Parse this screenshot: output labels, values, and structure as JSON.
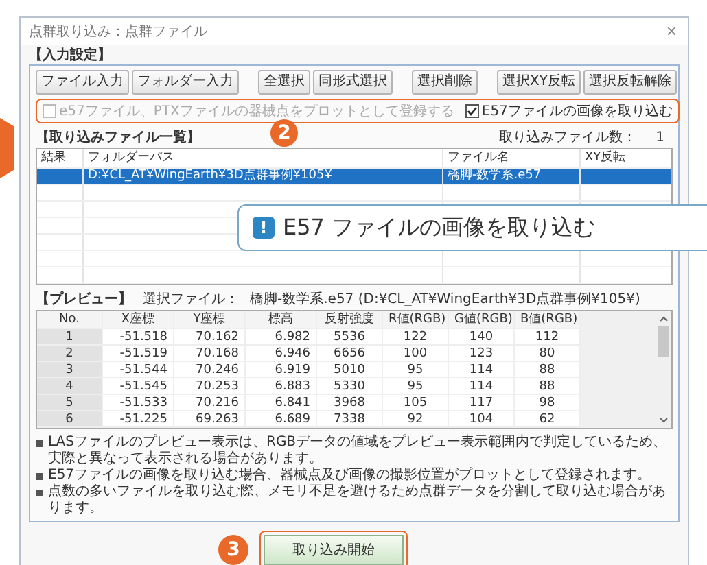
{
  "window": {
    "title": "点群取り込み：点群ファイル",
    "close": "×"
  },
  "input_settings": {
    "title": "【入力設定】",
    "buttons": [
      "ファイル入力",
      "フォルダー入力",
      "全選択",
      "同形式選択",
      "選択削除",
      "選択XY反転",
      "選択反転解除"
    ],
    "options": [
      {
        "label": "e57ファイル、PTXファイルの器械点をプロットとして登録する",
        "checked": false,
        "disabled": true
      },
      {
        "label": "E57ファイルの画像を取り込む",
        "checked": true,
        "disabled": false
      }
    ],
    "step": "2"
  },
  "file_list": {
    "title": "【取り込みファイル一覧】",
    "count_label": "取り込みファイル数：",
    "count": "1",
    "columns": [
      "結果",
      "フォルダーパス",
      "ファイル名",
      "XY反転"
    ],
    "rows": [
      {
        "folder": "D:¥CL_AT¥WingEarth¥3D点群事例¥105¥",
        "file": "橋脚-数学系.e57",
        "selected": true
      }
    ]
  },
  "callout": {
    "icon": "!",
    "text": "E57 ファイルの画像を取り込む"
  },
  "preview": {
    "title": "【プレビュー】",
    "file_label": "選択ファイル：",
    "file": "橋脚-数学系.e57 (D:¥CL_AT¥WingEarth¥3D点群事例¥105¥)",
    "columns": [
      "No.",
      "X座標",
      "Y座標",
      "標高",
      "反射強度",
      "R値(RGB)",
      "G値(RGB)",
      "B値(RGB)"
    ],
    "rows": [
      [
        "1",
        "-51.518",
        "70.162",
        "6.982",
        "5536",
        "122",
        "140",
        "112"
      ],
      [
        "2",
        "-51.519",
        "70.168",
        "6.946",
        "6656",
        "100",
        "123",
        "80"
      ],
      [
        "3",
        "-51.544",
        "70.246",
        "6.919",
        "5010",
        "95",
        "114",
        "88"
      ],
      [
        "4",
        "-51.545",
        "70.253",
        "6.883",
        "5330",
        "95",
        "114",
        "88"
      ],
      [
        "5",
        "-51.533",
        "70.216",
        "6.841",
        "3968",
        "105",
        "117",
        "98"
      ],
      [
        "6",
        "-51.225",
        "69.263",
        "6.689",
        "7338",
        "92",
        "104",
        "62"
      ]
    ]
  },
  "notes": [
    "LASファイルのプレビュー表示は、RGBデータの値域をプレビュー表示範囲内で判定しているため、実際と異なって表示される場合があります。",
    "E57ファイルの画像を取り込む場合、器械点及び画像の撮影位置がプロットとして登録されます。",
    "点数の多いファイルを取り込む際、メモリ不足を避けるため点群データを分割して取り込む場合があります。"
  ],
  "start": {
    "label": "取り込み開始",
    "step": "3"
  }
}
